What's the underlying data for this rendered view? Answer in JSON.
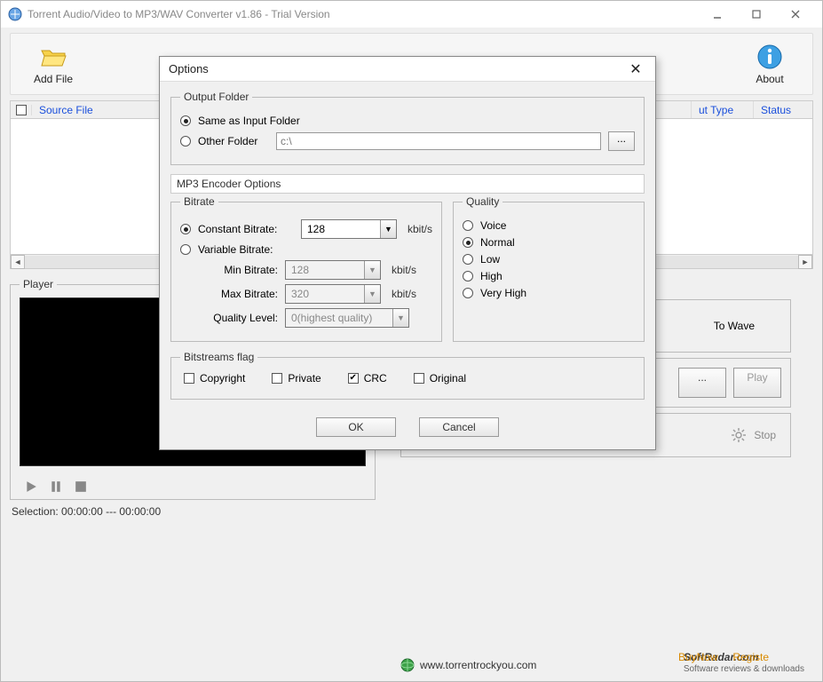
{
  "window": {
    "title": "Torrent Audio/Video to MP3/WAV Converter v1.86 - Trial Version"
  },
  "toolbar": {
    "addfile": "Add File",
    "about": "About"
  },
  "filelist": {
    "source_col": "Source File",
    "outtype_col": "ut Type",
    "status_col": "Status"
  },
  "player": {
    "legend": "Player",
    "selection": "Selection:  00:00:00 --- 00:00:00"
  },
  "right": {
    "to_wave": "To Wave",
    "browse": "...",
    "play": "Play",
    "stop": "Stop"
  },
  "footer": {
    "url": "www.torrentrockyou.com",
    "brand": "SoftRadar.com",
    "brand_sub": "Software reviews & downloads",
    "buynow": "BuyNow",
    "register": "Registe"
  },
  "dialog": {
    "title": "Options",
    "output_folder": {
      "legend": "Output Folder",
      "same": "Same as Input Folder",
      "other": "Other Folder",
      "path": "c:\\",
      "browse": "..."
    },
    "encoder_label": "MP3 Encoder Options",
    "bitrate": {
      "legend": "Bitrate",
      "constant": "Constant Bitrate:",
      "variable": "Variable Bitrate:",
      "min_label": "Min Bitrate:",
      "max_label": "Max Bitrate:",
      "qlevel_label": "Quality Level:",
      "const_val": "128",
      "min_val": "128",
      "max_val": "320",
      "qlevel_val": "0(highest quality)",
      "unit": "kbit/s"
    },
    "quality": {
      "legend": "Quality",
      "voice": "Voice",
      "normal": "Normal",
      "low": "Low",
      "high": "High",
      "veryhigh": "Very High"
    },
    "flags": {
      "legend": "Bitstreams flag",
      "copyright": "Copyright",
      "private": "Private",
      "crc": "CRC",
      "original": "Original"
    },
    "ok": "OK",
    "cancel": "Cancel"
  }
}
